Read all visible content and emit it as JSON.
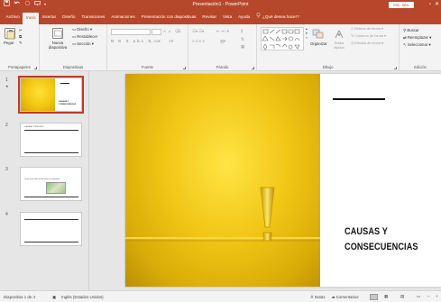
{
  "window": {
    "title": "Presentación1 - PowerPoint",
    "signin_label": "Inic. ses.",
    "qat_icons": [
      "save-icon",
      "undo-icon",
      "redo-icon",
      "present-icon",
      "customize-icon"
    ],
    "controls": [
      "minimize",
      "maximize",
      "close"
    ]
  },
  "tabs": [
    {
      "label": "Archivo"
    },
    {
      "label": "Inicio",
      "active": true
    },
    {
      "label": "Insertar"
    },
    {
      "label": "Diseño"
    },
    {
      "label": "Transiciones"
    },
    {
      "label": "Animaciones"
    },
    {
      "label": "Presentación con diapositivas"
    },
    {
      "label": "Revisar"
    },
    {
      "label": "Vista"
    },
    {
      "label": "Ayuda"
    }
  ],
  "tell_me": "¿Qué desea hacer?",
  "ribbon": {
    "clipboard": {
      "label": "Portapapeles",
      "paste": "Pegar"
    },
    "slides": {
      "label": "Diapositivas",
      "new_slide": "Nueva diapositiva",
      "layout": "Diseño",
      "reset": "Restablecer",
      "section": "Sección"
    },
    "font": {
      "label": "Fuente",
      "size_up": "A",
      "size_down": "A"
    },
    "paragraph": {
      "label": "Párrafo"
    },
    "drawing": {
      "label": "Dibujo",
      "arrange": "Organizar",
      "quick_styles": "Estilos rápidos",
      "shape_fill": "Relleno de forma",
      "shape_outline": "Contorno de forma",
      "shape_effects": "Efectos de forma"
    },
    "editing": {
      "label": "Edición",
      "find": "Buscar",
      "replace": "Reemplazar",
      "select": "Seleccionar"
    }
  },
  "thumbnails": [
    {
      "number": "1",
      "star": "★",
      "title_lines": "CAUSAS Y CONSECUENCIAS"
    },
    {
      "number": "2",
      "text": "CAUSAS Y RIESGOS"
    },
    {
      "number": "3",
      "text": "Lorem ipsum dolor sit amet texto de la diapositiva"
    },
    {
      "number": "4"
    }
  ],
  "slide": {
    "title_line1": "CAUSAS Y",
    "title_line2": "CONSECUENCIAS",
    "accent_color": "#f1c514"
  },
  "status": {
    "slide_count": "Diapositiva 1 de 4",
    "language": "Inglés (Estados Unidos)",
    "notes": "Notas",
    "comments": "Comentarios",
    "zoom": "+"
  }
}
